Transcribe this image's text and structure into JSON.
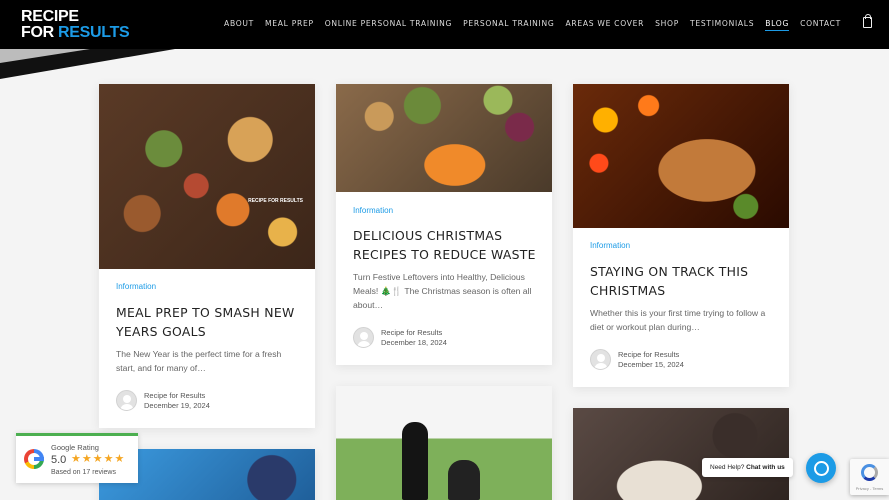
{
  "header": {
    "logo_line1": "RECIPE",
    "logo_line2_white": "FOR ",
    "logo_line2_blue": "RESULTS",
    "nav": [
      "ABOUT",
      "MEAL PREP",
      "ONLINE PERSONAL TRAINING",
      "PERSONAL TRAINING",
      "AREAS WE COVER",
      "SHOP",
      "TESTIMONIALS",
      "BLOG",
      "CONTACT"
    ],
    "active_nav": "BLOG",
    "cart_icon": "shopping-bag-icon"
  },
  "posts": [
    {
      "category": "Information",
      "title": "MEAL PREP TO SMASH NEW YEARS GOALS",
      "excerpt": "The New Year is the perfect time for a fresh start, and for many of…",
      "author": "Recipe for Results",
      "date": "December 19, 2024",
      "image_brand": "RECIPE FOR RESULTS"
    },
    {
      "category": "Information",
      "title": "DELICIOUS CHRISTMAS RECIPES TO REDUCE WASTE",
      "excerpt": "Turn Festive Leftovers into Healthy, Delicious Meals! 🎄🍴 The Christmas season is often all about…",
      "author": "Recipe for Results",
      "date": "December 18, 2024"
    },
    {
      "category": "Information",
      "title": "STAYING ON TRACK THIS CHRISTMAS",
      "excerpt": "Whether this is your first time trying to follow a diet or workout plan during…",
      "author": "Recipe for Results",
      "date": "December 15, 2024"
    }
  ],
  "google_rating": {
    "label": "Google Rating",
    "score": "5.0",
    "stars": "★★★★★",
    "count": "Based on 17 reviews"
  },
  "chat": {
    "prefix": "Need Help? ",
    "label": "Chat with us"
  },
  "recaptcha": {
    "text": "Privacy - Terms"
  },
  "colors": {
    "accent": "#1c9be6",
    "header_bg": "#000000",
    "page_bg": "#f4f4f4"
  }
}
